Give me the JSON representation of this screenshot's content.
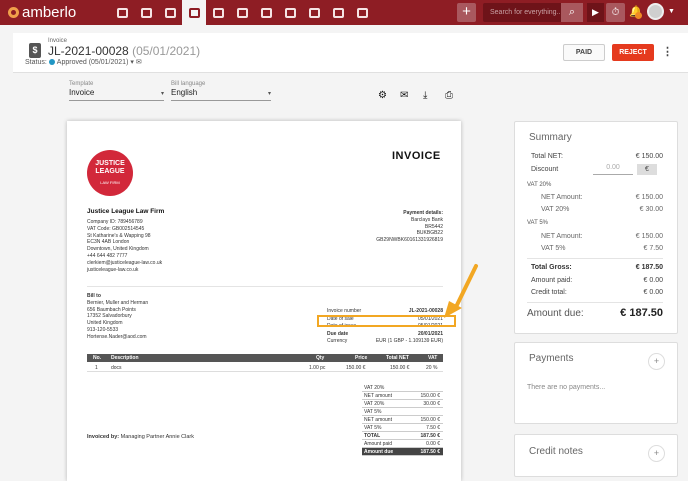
{
  "app": {
    "name": "amberlo"
  },
  "topbar": {
    "nav_icons": [
      "dashboard-icon",
      "contacts-icon",
      "matters-icon",
      "billing-icon",
      "bank-icon",
      "calendar-icon",
      "time-icon",
      "folder-icon",
      "documents-icon",
      "mail-icon",
      "reports-icon"
    ],
    "search_placeholder": "Search for everything...",
    "plus": "+",
    "search_glyph": "⌕",
    "play": "▶",
    "timer": "⏱",
    "bell": "🔔",
    "caret": "▼"
  },
  "header": {
    "small_label": "Invoice",
    "title": "JL-2021-00028",
    "title_date": "(05/01/2021)",
    "status_label": "Status:",
    "status_value": "Approved (05/01/2021)",
    "status_caret": "▾",
    "status_mail": "✉",
    "paid_label": "PAID",
    "reject_label": "REJECT",
    "doc_glyph": "$",
    "kebab": "⋮"
  },
  "options": {
    "template_label": "Template",
    "template_value": "Invoice",
    "language_label": "Bill language",
    "language_value": "English",
    "select_caret": "▾"
  },
  "toolbar": {
    "settings": "⚙",
    "mail": "✉",
    "download": "⤓",
    "print": "⎙"
  },
  "invoice": {
    "logo_line1": "JUSTICE",
    "logo_line2": "LEAGUE",
    "logo_sub": "LAW FIRM",
    "title": "INVOICE",
    "firm_name": "Justice League Law Firm",
    "firm_lines": [
      "Company ID: 789456789",
      "VAT Code: GB002514545",
      "St Katharine's & Wapping 98",
      "EC3N 4AB London",
      "Downtown, United Kingdom",
      "+44 644 482 7777",
      "clerkiem@justiceleague-law.co.uk",
      "justiceleague-law.co.uk"
    ],
    "payment_title": "Payment details:",
    "payment_lines": [
      "Barclays Bank",
      "BR5442",
      "BUKBGB22",
      "GB29NWBK60161331926819"
    ],
    "bill_to_label": "Bill to",
    "bill_to_lines": [
      "Bernier, Muller and Herman",
      "656 Baumbach Points",
      "17352 Salvadorbury",
      "United Kingdom",
      "913-120-5533",
      "Hortense.Nader@aod.com"
    ],
    "meta": [
      {
        "k": "Invoice number",
        "v": "JL-2021-00028"
      },
      {
        "k": "Date of sale",
        "v": "05/01/2021"
      },
      {
        "k": "Date of issue",
        "v": "05/01/2021"
      },
      {
        "k": "Due date",
        "v": "20/01/2021"
      },
      {
        "k": "Currency",
        "v": "EUR (1 GBP - 1.109139 EUR)"
      }
    ],
    "table_headers": {
      "no": "No.",
      "desc": "Description",
      "qty": "Qty",
      "price": "Price",
      "total": "Total NET",
      "vat": "VAT"
    },
    "rows": [
      {
        "no": "1",
        "desc": "docs",
        "qty": "1.00 pc",
        "price": "150.00 €",
        "total": "150.00 €",
        "vat": "20 %"
      }
    ],
    "vat_summary": [
      {
        "k": "VAT 20%",
        "v": "",
        "style": "plain"
      },
      {
        "k": "NET amount",
        "v": "150.00 €",
        "style": "plain"
      },
      {
        "k": "VAT 20%",
        "v": "30.00 €",
        "style": "plain"
      },
      {
        "k": "VAT 5%",
        "v": "",
        "style": "plain"
      },
      {
        "k": "NET amount",
        "v": "150.00 €",
        "style": "plain"
      },
      {
        "k": "VAT 5%",
        "v": "7.50 €",
        "style": "plain"
      },
      {
        "k": "TOTAL",
        "v": "187.50 €",
        "style": "bold"
      },
      {
        "k": "Amount paid",
        "v": "0.00 €",
        "style": "plain"
      },
      {
        "k": "Amount due",
        "v": "187.50 €",
        "style": "dark"
      }
    ],
    "invoiced_by_label": "Invoiced by:",
    "invoiced_by_value": "Managing Partner Annie Clark"
  },
  "summary": {
    "title": "Summary",
    "total_net_label": "Total NET:",
    "total_net": "€ 150.00",
    "discount_label": "Discount",
    "discount_value": "0.00",
    "discount_currency": "€",
    "vat20_head": "VAT 20%",
    "net_amount_label": "NET Amount:",
    "net20": "€ 150.00",
    "vat20_label": "VAT 20%",
    "vat20": "€ 30.00",
    "vat5_head": "VAT 5%",
    "net5": "€ 150.00",
    "vat5_label": "VAT 5%",
    "vat5": "€ 7.50",
    "total_gross_label": "Total Gross:",
    "total_gross": "€ 187.50",
    "amount_paid_label": "Amount paid:",
    "amount_paid": "€ 0.00",
    "credit_total_label": "Credit total:",
    "credit_total": "€ 0.00",
    "amount_due_label": "Amount due:",
    "amount_due": "€ 187.50"
  },
  "payments": {
    "title": "Payments",
    "empty": "There are no payments...",
    "add": "+"
  },
  "credit_notes": {
    "title": "Credit notes",
    "add": "+"
  },
  "colors": {
    "brand": "#8e1d24",
    "reject": "#e53a1e",
    "highlight": "#f2a723",
    "status": "#2196c4"
  }
}
